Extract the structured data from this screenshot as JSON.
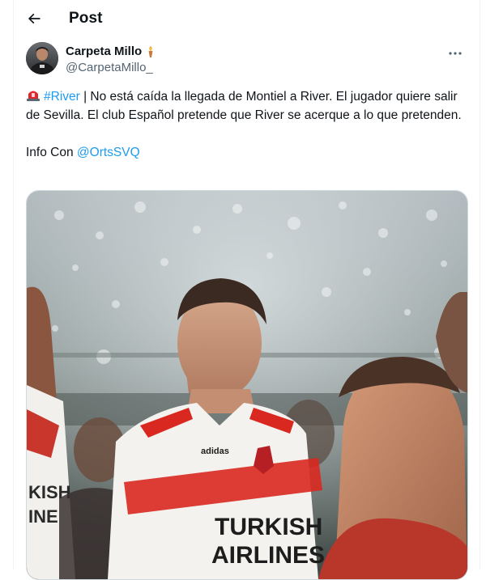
{
  "header": {
    "title": "Post",
    "back_icon": "arrow-left-icon"
  },
  "author": {
    "display_name": "Carpeta Millo",
    "name_emoji": "torch-icon",
    "handle": "@CarpetaMillo_"
  },
  "tweet": {
    "emoji": "rotating-light-icon",
    "hashtag": "#River",
    "text_after_hashtag": " | No está caída la llegada de Montiel a River. El jugador quiere salir de Sevilla. El club Español pretende que River se acerque a lo que pretenden.",
    "info_prefix": "Info Con ",
    "mention": "@OrtsSVQ"
  },
  "media": {
    "kit_sponsor_line1": "TURKISH",
    "kit_sponsor_line2": "AIRLINES",
    "kit_maker": "adidas"
  },
  "colors": {
    "link": "#1d9bf0",
    "secondary_text": "#536471",
    "jersey_stripe": "#d9281f"
  }
}
